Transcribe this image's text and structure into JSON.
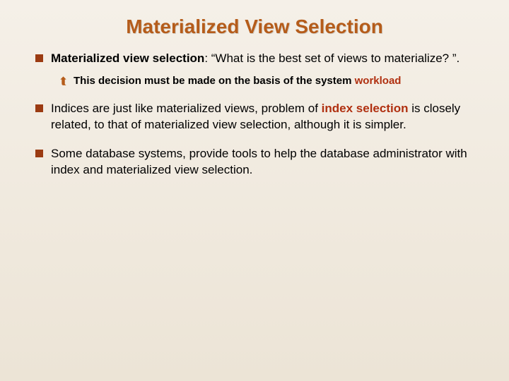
{
  "title": "Materialized View Selection",
  "bullets": [
    {
      "lead": "Materialized view selection",
      "rest": ": “What is the best set of views to materialize? ”.",
      "sub": {
        "pre": "This decision must be made on the basis of the system ",
        "hl": "workload"
      }
    },
    {
      "pre": "Indices are just like materialized views, problem of ",
      "hl": "index selection",
      "post": " is closely related, to that of materialized view selection, although it is simpler."
    },
    {
      "text": "Some database systems, provide tools to help the database administrator with index and materialized view selection."
    }
  ]
}
